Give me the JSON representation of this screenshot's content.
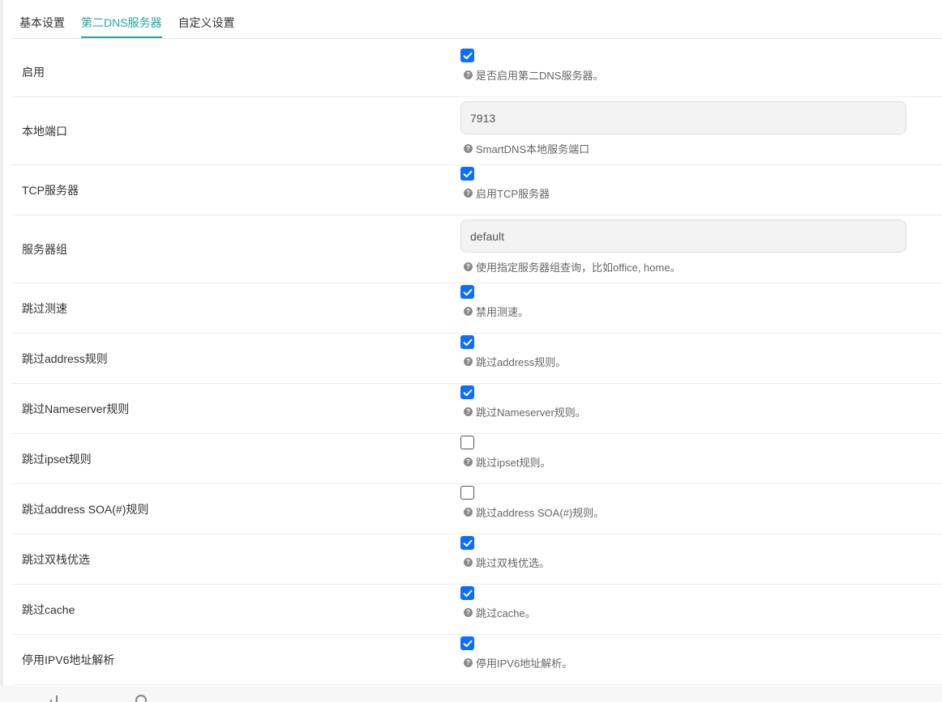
{
  "tabs": [
    {
      "label": "基本设置",
      "active": false
    },
    {
      "label": "第二DNS服务器",
      "active": true
    },
    {
      "label": "自定义设置",
      "active": false
    }
  ],
  "colors": {
    "accent": "#26a69a",
    "checkbox_on": "#0d6efd"
  },
  "help_icon_glyph": "?",
  "rows": [
    {
      "label": "启用",
      "type": "checkbox",
      "checked": true,
      "help": "是否启用第二DNS服务器。"
    },
    {
      "label": "本地端口",
      "type": "text",
      "value": "7913",
      "help": "SmartDNS本地服务端口"
    },
    {
      "label": "TCP服务器",
      "type": "checkbox",
      "checked": true,
      "help": "启用TCP服务器"
    },
    {
      "label": "服务器组",
      "type": "text",
      "value": "default",
      "help": "使用指定服务器组查询，比如office, home。"
    },
    {
      "label": "跳过测速",
      "type": "checkbox",
      "checked": true,
      "help": "禁用测速。"
    },
    {
      "label": "跳过address规则",
      "type": "checkbox",
      "checked": true,
      "help": "跳过address规则。"
    },
    {
      "label": "跳过Nameserver规则",
      "type": "checkbox",
      "checked": true,
      "help": "跳过Nameserver规则。"
    },
    {
      "label": "跳过ipset规则",
      "type": "checkbox",
      "checked": false,
      "help": "跳过ipset规则。"
    },
    {
      "label": "跳过address SOA(#)规则",
      "type": "checkbox",
      "checked": false,
      "help": "跳过address SOA(#)规则。"
    },
    {
      "label": "跳过双栈优选",
      "type": "checkbox",
      "checked": true,
      "help": "跳过双栈优选。"
    },
    {
      "label": "跳过cache",
      "type": "checkbox",
      "checked": true,
      "help": "跳过cache。"
    },
    {
      "label": "停用IPV6地址解析",
      "type": "checkbox",
      "checked": true,
      "help": "停用IPV6地址解析。"
    }
  ]
}
